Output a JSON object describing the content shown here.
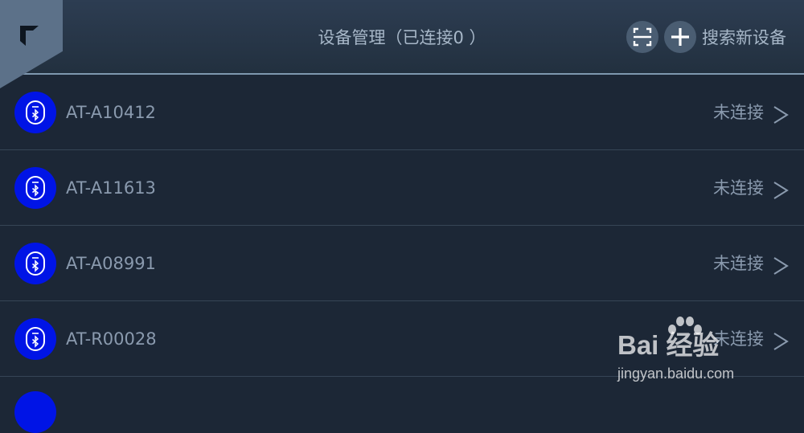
{
  "header": {
    "title": "设备管理（已连接0 ）",
    "search_label": "搜索新设备"
  },
  "icons": {
    "back": "back-corner-icon",
    "scan": "scan-icon",
    "add": "plus-icon",
    "device": "bluetooth-device-icon",
    "chevron": "chevron-right-icon"
  },
  "colors": {
    "background": "#1c2736",
    "header": "#2d3d52",
    "device_icon": "#0014e6",
    "text": "#8a9aae"
  },
  "devices": [
    {
      "name": "AT-A10412",
      "status": "未连接"
    },
    {
      "name": "AT-A11613",
      "status": "未连接"
    },
    {
      "name": "AT-A08991",
      "status": "未连接"
    },
    {
      "name": "AT-R00028",
      "status": "未连接"
    }
  ],
  "watermark": {
    "brand": "Bai 经验",
    "url": "jingyan.baidu.com"
  }
}
